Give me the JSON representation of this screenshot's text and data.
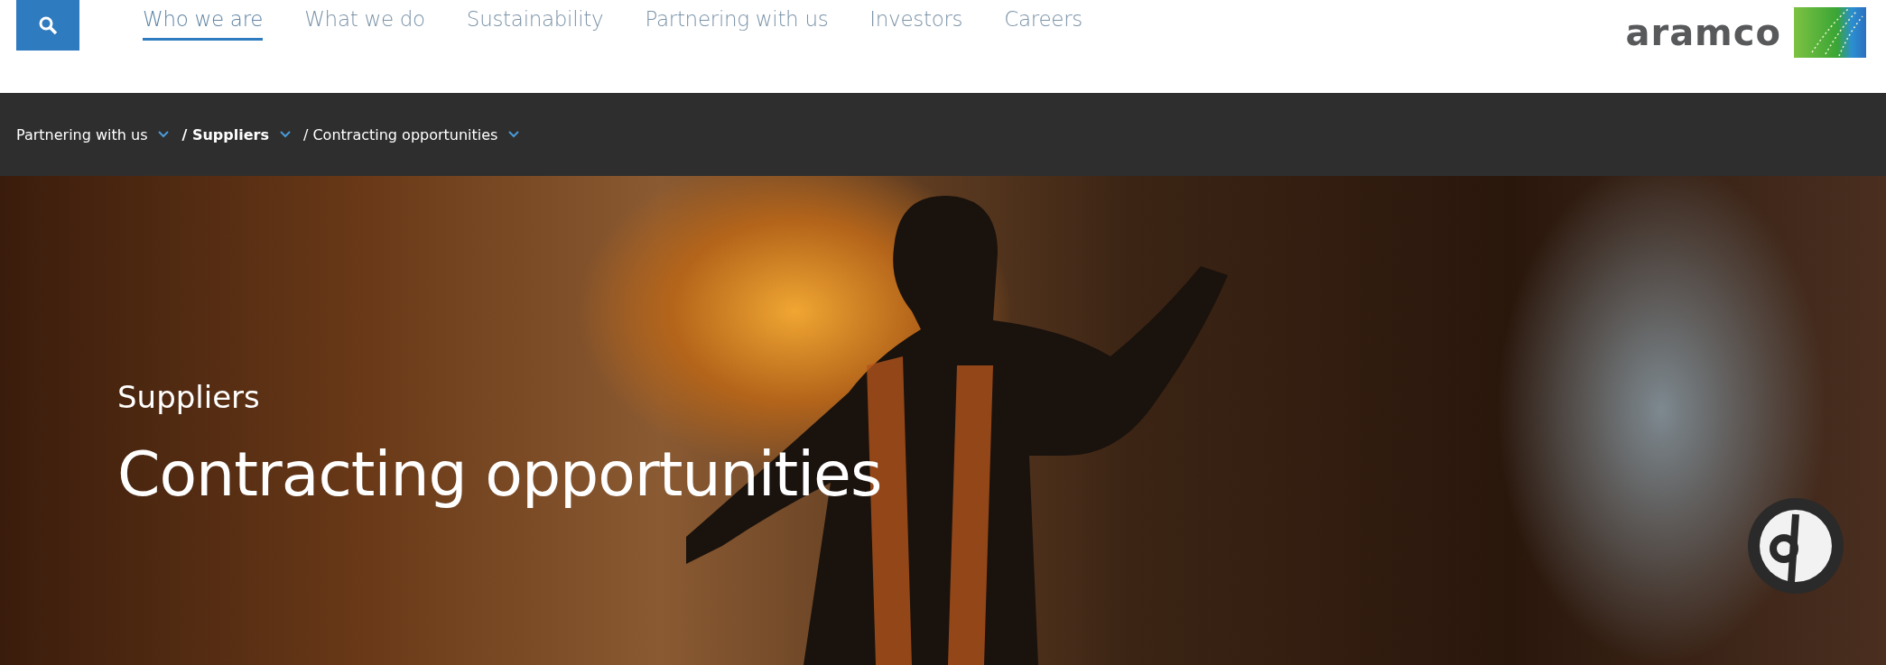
{
  "header": {
    "nav_items": [
      {
        "label": "Who we are",
        "selected": true
      },
      {
        "label": "What we do",
        "selected": false
      },
      {
        "label": "Sustainability",
        "selected": false
      },
      {
        "label": "Partnering with us",
        "selected": false
      },
      {
        "label": "Investors",
        "selected": false
      },
      {
        "label": "Careers",
        "selected": false
      }
    ],
    "logo_text": "aramco"
  },
  "breadcrumb": [
    {
      "label": "Partnering with us",
      "current_section": false
    },
    {
      "label": "/ Suppliers",
      "current_section": true
    },
    {
      "label": "/ Contracting opportunities",
      "current_section": false
    }
  ],
  "hero": {
    "eyebrow": "Suppliers",
    "title": "Contracting opportunities"
  }
}
